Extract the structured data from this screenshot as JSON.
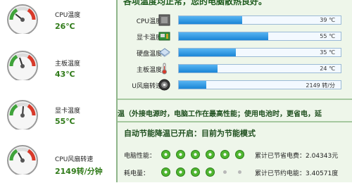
{
  "sidebar": {
    "sensors": [
      {
        "label": "CPU温度",
        "value": "26℃",
        "gauge_level": 0.2
      },
      {
        "label": "主板温度",
        "value": "43℃",
        "gauge_level": 0.4
      },
      {
        "label": "显卡温度",
        "value": "55℃",
        "gauge_level": 0.5
      },
      {
        "label": "CPU风扇转速",
        "value": "2149转/分钟",
        "gauge_level": 0.35
      }
    ]
  },
  "main": {
    "headline": "各项温度均正常，您的电脑散热良好。",
    "rows": [
      {
        "label": "CPU温度",
        "value": "39 ℃",
        "fill": 0.39,
        "icon": "cpu-icon"
      },
      {
        "label": "显卡温度",
        "value": "55 ℃",
        "fill": 0.55,
        "icon": "graphics-card-icon"
      },
      {
        "label": "硬盘温度",
        "value": "35 ℃",
        "fill": 0.35,
        "icon": "hard-disk-icon"
      },
      {
        "label": "主板温度",
        "value": "24 ℃",
        "fill": 0.24,
        "icon": "thermometer-icon"
      },
      {
        "label": "U风扇转速",
        "value": "2149 转/分",
        "fill": 0.17,
        "icon": "fan-icon"
      }
    ],
    "ticker": "温（外接电源时，电脑工作在最高性能；使用电池时，更省电，延",
    "eco": {
      "title": "自动节能降温已开启：目前为节能模式",
      "perf": {
        "label": "电脑性能：",
        "dots_total": 6,
        "dots_on": 6,
        "stat": "累计已节省电费：2.04343元"
      },
      "power": {
        "label": "耗电量：",
        "dots_total": 6,
        "dots_on": 4,
        "stat": "累计已节约电能：3.40571度"
      }
    }
  },
  "colors": {
    "accent_green": "#2f7a18",
    "bar_blue": "#1b86d6",
    "panel_bg": "#eef6ea"
  }
}
